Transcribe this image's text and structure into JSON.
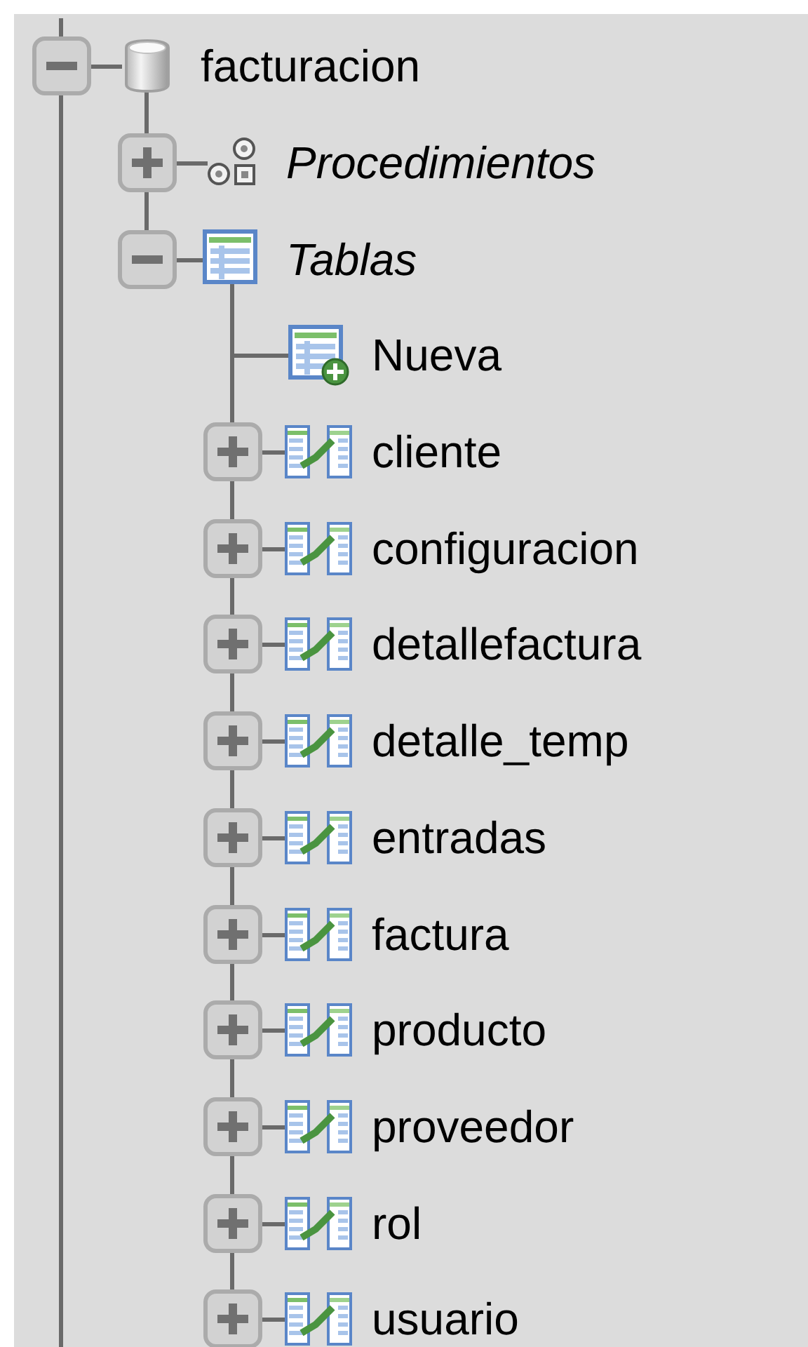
{
  "tree": [
    {
      "label": "facturacion",
      "kind": "database",
      "expanded": true,
      "children": [
        {
          "label": "Procedimientos",
          "kind": "group",
          "expanded": false
        },
        {
          "label": "Tablas",
          "kind": "group",
          "expanded": true,
          "children": [
            {
              "label": "Nueva",
              "kind": "new"
            },
            {
              "label": "cliente",
              "kind": "table",
              "expanded": false
            },
            {
              "label": "configuracion",
              "kind": "table",
              "expanded": false
            },
            {
              "label": "detallefactura",
              "kind": "table",
              "expanded": false
            },
            {
              "label": "detalle_temp",
              "kind": "table",
              "expanded": false
            },
            {
              "label": "entradas",
              "kind": "table",
              "expanded": false
            },
            {
              "label": "factura",
              "kind": "table",
              "expanded": false
            },
            {
              "label": "producto",
              "kind": "table",
              "expanded": false
            },
            {
              "label": "proveedor",
              "kind": "table",
              "expanded": false
            },
            {
              "label": "rol",
              "kind": "table",
              "expanded": false
            },
            {
              "label": "usuario",
              "kind": "table",
              "expanded": false
            }
          ]
        }
      ]
    }
  ]
}
